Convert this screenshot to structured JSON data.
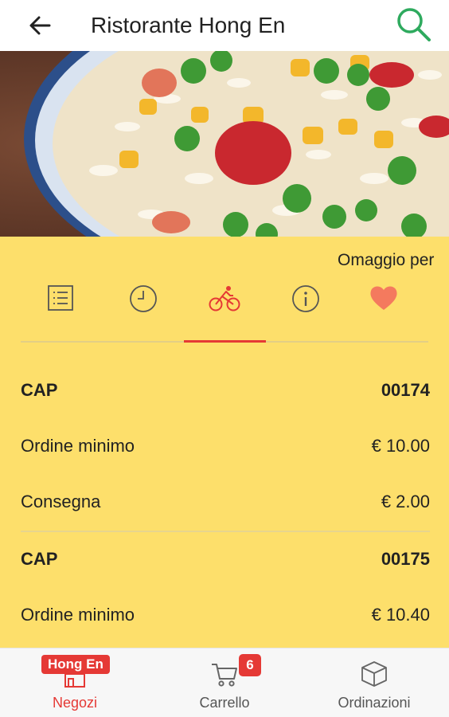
{
  "header": {
    "title": "Ristorante Hong En",
    "back_icon": "arrow-left-icon",
    "search_icon": "search-icon"
  },
  "hero": {
    "image": "fried-rice-photo"
  },
  "panel": {
    "marquee_text": "Omaggio per",
    "tabs": [
      {
        "icon": "menu-list-icon",
        "active": false
      },
      {
        "icon": "clock-icon",
        "active": false
      },
      {
        "icon": "bicycle-icon",
        "active": true
      },
      {
        "icon": "info-icon",
        "active": false
      },
      {
        "icon": "heart-icon",
        "active": false
      }
    ],
    "delivery_zones": [
      {
        "cap_label": "CAP",
        "cap_value": "00174",
        "min_label": "Ordine minimo",
        "min_value": "€ 10.00",
        "fee_label": "Consegna",
        "fee_value": "€ 2.00"
      },
      {
        "cap_label": "CAP",
        "cap_value": "00175",
        "min_label": "Ordine minimo",
        "min_value": "€ 10.40"
      }
    ]
  },
  "bottom_nav": {
    "items": [
      {
        "label": "Negozi",
        "badge": "Hong En",
        "icon": "store-icon",
        "active": true
      },
      {
        "label": "Carrello",
        "badge": "6",
        "icon": "cart-icon",
        "active": false
      },
      {
        "label": "Ordinazioni",
        "icon": "box-icon",
        "active": false
      }
    ]
  },
  "colors": {
    "accent": "#e53935",
    "panel_bg": "#fddf6b",
    "search_green": "#2eaa5e"
  }
}
